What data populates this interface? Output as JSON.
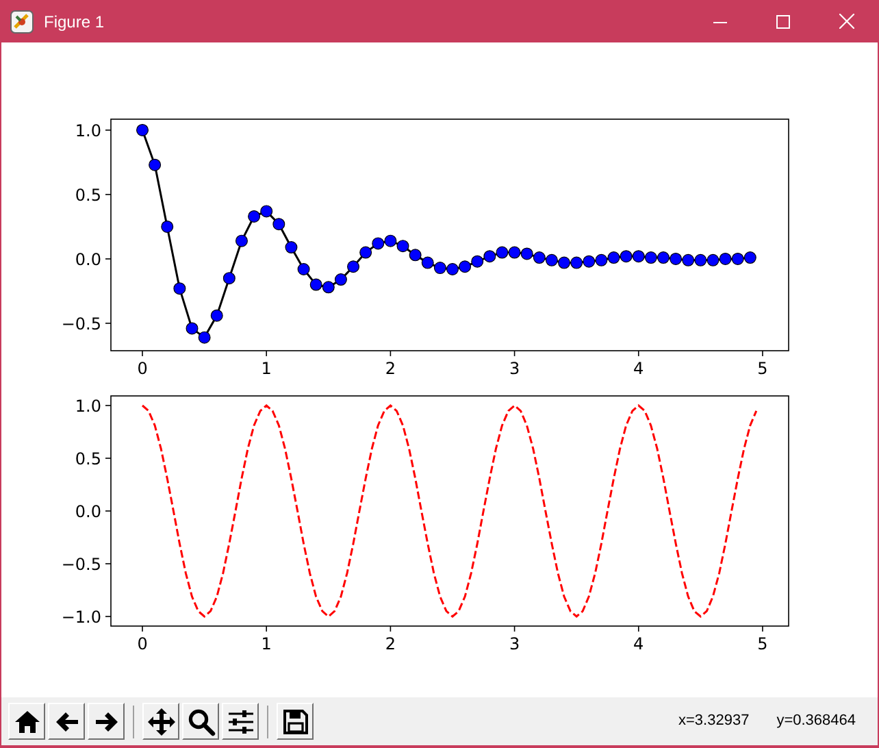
{
  "window": {
    "title": "Figure 1"
  },
  "figure": {
    "axes": [
      {
        "chart_data": {
          "type": "line",
          "x": [
            0,
            0.1,
            0.2,
            0.3,
            0.4,
            0.5,
            0.6,
            0.7,
            0.8,
            0.9,
            1,
            1.1,
            1.2,
            1.3,
            1.4,
            1.5,
            1.6,
            1.7,
            1.8,
            1.9,
            2,
            2.1,
            2.2,
            2.3,
            2.4,
            2.5,
            2.6,
            2.7,
            2.8,
            2.9,
            3,
            3.1,
            3.2,
            3.3,
            3.4,
            3.5,
            3.6,
            3.7,
            3.8,
            3.9,
            4,
            4.1,
            4.2,
            4.3,
            4.4,
            4.5,
            4.6,
            4.7,
            4.8,
            4.9
          ],
          "series": [
            {
              "color": "#0000ff",
              "marker": "circle",
              "line_style": "solid",
              "values": [
                1,
                0.73,
                0.25,
                -0.23,
                -0.54,
                -0.61,
                -0.44,
                -0.15,
                0.14,
                0.33,
                0.37,
                0.27,
                0.09,
                -0.08,
                -0.2,
                -0.22,
                -0.16,
                -0.06,
                0.05,
                0.12,
                0.14,
                0.1,
                0.03,
                -0.03,
                -0.07,
                -0.08,
                -0.06,
                -0.02,
                0.02,
                0.05,
                0.05,
                0.04,
                0.01,
                -0.01,
                -0.03,
                -0.03,
                -0.02,
                -0.01,
                0.01,
                0.02,
                0.02,
                0.01,
                0.01,
                0,
                -0.01,
                -0.01,
                -0.01,
                0,
                0,
                0.01
              ]
            }
          ],
          "xlim": [
            -0.254,
            5.21
          ],
          "ylim": [
            -0.713,
            1.085
          ],
          "xticks": [
            0,
            1,
            2,
            3,
            4,
            5
          ],
          "yticks": [
            {
              "value": -0.5,
              "label": "−0.5"
            },
            {
              "value": 0,
              "label": "0.0"
            },
            {
              "value": 0.5,
              "label": "0.5"
            },
            {
              "value": 1,
              "label": "1.0"
            }
          ]
        }
      },
      {
        "chart_data": {
          "type": "line",
          "x": [
            0,
            0.05,
            0.1,
            0.15,
            0.2,
            0.25,
            0.3,
            0.35,
            0.4,
            0.45,
            0.5,
            0.55,
            0.6,
            0.65,
            0.7,
            0.75,
            0.8,
            0.85,
            0.9,
            0.95,
            1,
            1.05,
            1.1,
            1.15,
            1.2,
            1.25,
            1.3,
            1.35,
            1.4,
            1.45,
            1.5,
            1.55,
            1.6,
            1.65,
            1.7,
            1.75,
            1.8,
            1.85,
            1.9,
            1.95,
            2,
            2.05,
            2.1,
            2.15,
            2.2,
            2.25,
            2.3,
            2.35,
            2.4,
            2.45,
            2.5,
            2.55,
            2.6,
            2.65,
            2.7,
            2.75,
            2.8,
            2.85,
            2.9,
            2.95,
            3,
            3.05,
            3.1,
            3.15,
            3.2,
            3.25,
            3.3,
            3.35,
            3.4,
            3.45,
            3.5,
            3.55,
            3.6,
            3.65,
            3.7,
            3.75,
            3.8,
            3.85,
            3.9,
            3.95,
            4,
            4.05,
            4.1,
            4.15,
            4.2,
            4.25,
            4.3,
            4.35,
            4.4,
            4.45,
            4.5,
            4.55,
            4.6,
            4.65,
            4.7,
            4.75,
            4.8,
            4.85,
            4.9,
            4.95
          ],
          "series": [
            {
              "color": "#ff0000",
              "line_style": "dashed",
              "values": [
                1,
                0.95,
                0.81,
                0.59,
                0.31,
                0,
                -0.31,
                -0.59,
                -0.81,
                -0.95,
                -1,
                -0.95,
                -0.81,
                -0.59,
                -0.31,
                0,
                0.31,
                0.59,
                0.81,
                0.95,
                1,
                0.95,
                0.81,
                0.59,
                0.31,
                0,
                -0.31,
                -0.59,
                -0.81,
                -0.95,
                -1,
                -0.95,
                -0.81,
                -0.59,
                -0.31,
                0,
                0.31,
                0.59,
                0.81,
                0.95,
                1,
                0.95,
                0.81,
                0.59,
                0.31,
                0,
                -0.31,
                -0.59,
                -0.81,
                -0.95,
                -1,
                -0.95,
                -0.81,
                -0.59,
                -0.31,
                0,
                0.31,
                0.59,
                0.81,
                0.95,
                1,
                0.95,
                0.81,
                0.59,
                0.31,
                0,
                -0.31,
                -0.59,
                -0.81,
                -0.95,
                -1,
                -0.95,
                -0.81,
                -0.59,
                -0.31,
                0,
                0.31,
                0.59,
                0.81,
                0.95,
                1,
                0.95,
                0.81,
                0.59,
                0.31,
                0,
                -0.31,
                -0.59,
                -0.81,
                -0.95,
                -1,
                -0.95,
                -0.81,
                -0.59,
                -0.31,
                0,
                0.31,
                0.59,
                0.81,
                0.95
              ]
            }
          ],
          "xlim": [
            -0.254,
            5.21
          ],
          "ylim": [
            -1.091,
            1.091
          ],
          "xticks": [
            0,
            1,
            2,
            3,
            4,
            5
          ],
          "yticks": [
            {
              "value": -1,
              "label": "−1.0"
            },
            {
              "value": -0.5,
              "label": "−0.5"
            },
            {
              "value": 0,
              "label": "0.0"
            },
            {
              "value": 0.5,
              "label": "0.5"
            },
            {
              "value": 1,
              "label": "1.0"
            }
          ]
        }
      }
    ]
  },
  "toolbar": {
    "buttons": [
      {
        "kind": "home"
      },
      {
        "kind": "back"
      },
      {
        "kind": "forward"
      },
      {
        "kind": "separator"
      },
      {
        "kind": "pan"
      },
      {
        "kind": "zoom"
      },
      {
        "kind": "configure"
      },
      {
        "kind": "separator"
      },
      {
        "kind": "save"
      }
    ],
    "coordinates": [
      "x=3.32937",
      "y=0.368464"
    ]
  }
}
